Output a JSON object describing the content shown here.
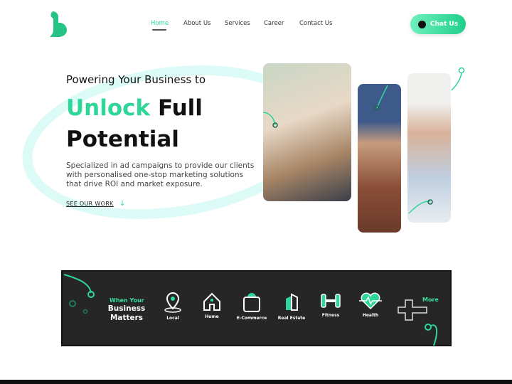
{
  "nav": {
    "items": [
      "Home",
      "About Us",
      "Services",
      "Career",
      "Contact Us"
    ],
    "active": "Home",
    "chat_label": "Chat Us"
  },
  "hero": {
    "kicker": "Powering Your Business to",
    "headline_accent": "Unlock",
    "headline_rest": "Full",
    "headline_line2": "Potential",
    "description": "Specialized in ad campaigns to provide our clients with personalised one-stop marketing solutions that drive ROI and market exposure.",
    "cta": "SEE OUR WORK"
  },
  "band": {
    "title_small": "When Your",
    "title_big": "Business Matters",
    "categories": [
      {
        "label": "Local",
        "icon": "map-pin-icon"
      },
      {
        "label": "Home",
        "icon": "house-icon"
      },
      {
        "label": "E-Commerce",
        "icon": "shopping-bag-icon"
      },
      {
        "label": "Real Estate",
        "icon": "building-icon"
      },
      {
        "label": "Fitness",
        "icon": "dumbbell-icon"
      },
      {
        "label": "Health",
        "icon": "heart-pulse-icon"
      }
    ],
    "more": "More"
  },
  "colors": {
    "accent": "#2ed69a",
    "dark": "#262626"
  }
}
